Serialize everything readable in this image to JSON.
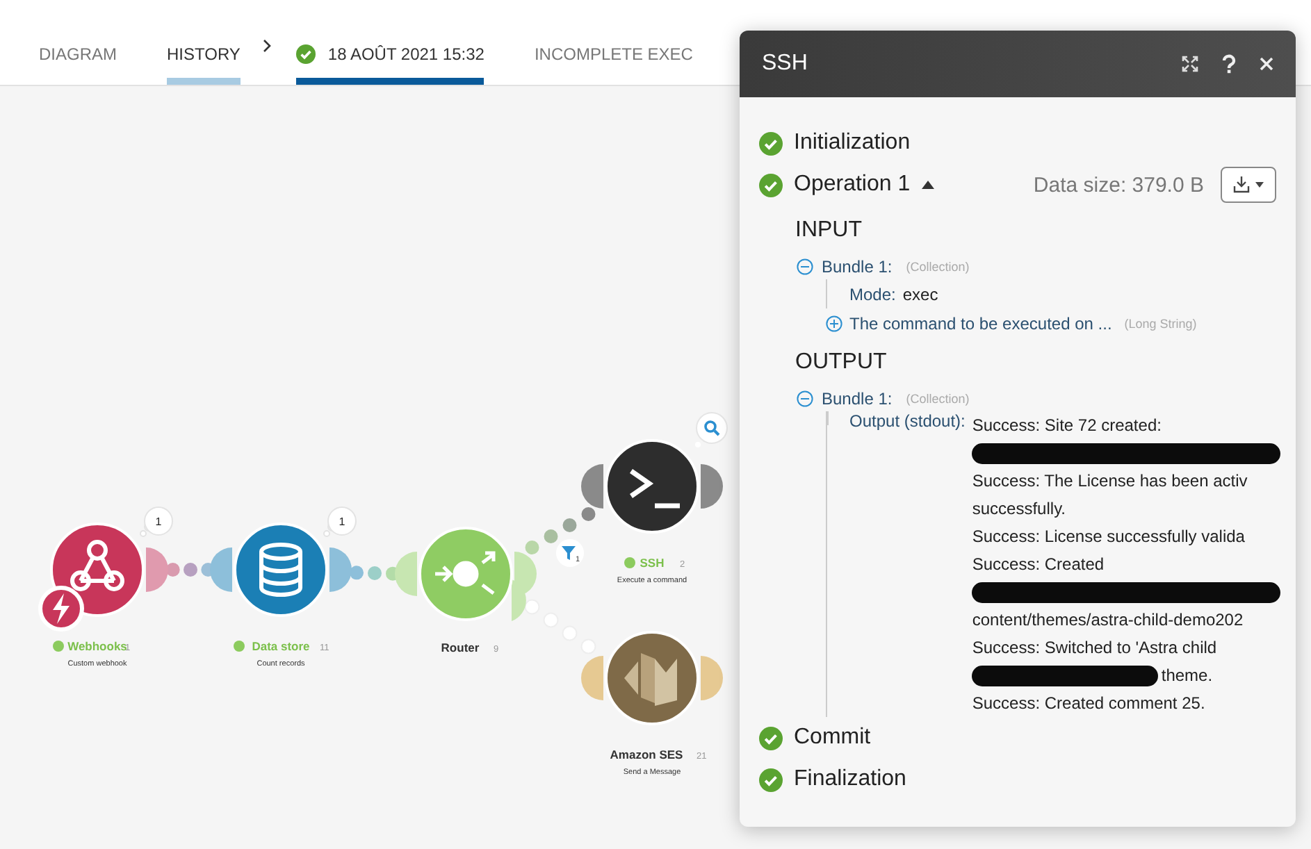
{
  "tabs": [
    {
      "label": "DIAGRAM",
      "selected": false,
      "in_path": false
    },
    {
      "label": "HISTORY",
      "selected": false,
      "in_path": true
    },
    {
      "label": "18 AOÛT 2021 15:32",
      "selected": true,
      "in_path": false,
      "success": true
    },
    {
      "label": "INCOMPLETE EXEC",
      "selected": false,
      "in_path": false
    }
  ],
  "canvas": {
    "nodes": [
      {
        "kind": "webhooks",
        "name": "Webhooks",
        "number": "1",
        "subtitle": "Custom webhook",
        "success": true,
        "bubble": "1",
        "trigger": true
      },
      {
        "kind": "datastore",
        "name": "Data store",
        "number": "11",
        "subtitle": "Count records",
        "success": true,
        "bubble": "1"
      },
      {
        "kind": "router",
        "name": "Router",
        "number": "9"
      },
      {
        "kind": "ssh",
        "name": "SSH",
        "number": "2",
        "subtitle": "Execute a command",
        "success": true,
        "inspected": true
      },
      {
        "kind": "ses",
        "name": "Amazon SES",
        "number": "21",
        "subtitle": "Send a Message"
      }
    ],
    "filter_count": "1"
  },
  "panel": {
    "title": "SSH",
    "steps": [
      {
        "label": "Initialization",
        "success": true
      },
      {
        "label": "Operation 1",
        "success": true,
        "expanded": true,
        "data_size": "Data size: 379.0 B",
        "sections": [
          {
            "title": "INPUT",
            "bundle": {
              "label": "Bundle 1:",
              "type": "(Collection)",
              "expanded": true,
              "fields": [
                {
                  "kind": "value",
                  "label": "Mode:",
                  "value": "exec"
                },
                {
                  "kind": "collapsed",
                  "label": "The command to be executed on ...",
                  "type": "(Long String)"
                }
              ]
            }
          },
          {
            "title": "OUTPUT",
            "bundle": {
              "label": "Bundle 1:",
              "type": "(Collection)",
              "expanded": true,
              "fields": [
                {
                  "kind": "lines",
                  "label": "Output (stdout):",
                  "lines": [
                    {
                      "kind": "text",
                      "text": "Success: Site 72 created:"
                    },
                    {
                      "kind": "redacted"
                    },
                    {
                      "kind": "text",
                      "text": "Success: The License has been activ"
                    },
                    {
                      "kind": "text",
                      "text": "successfully."
                    },
                    {
                      "kind": "text",
                      "text": "Success: License successfully valida"
                    },
                    {
                      "kind": "text",
                      "text": "Success: Created"
                    },
                    {
                      "kind": "redacted"
                    },
                    {
                      "kind": "text",
                      "text": "content/themes/astra-child-demo202"
                    },
                    {
                      "kind": "text",
                      "text": "Success: Switched to 'Astra child"
                    },
                    {
                      "kind": "redacted",
                      "text": "theme."
                    },
                    {
                      "kind": "text",
                      "text": "Success: Created comment 25."
                    }
                  ]
                }
              ]
            }
          }
        ]
      },
      {
        "label": "Commit",
        "success": true
      },
      {
        "label": "Finalization",
        "success": true
      }
    ]
  }
}
